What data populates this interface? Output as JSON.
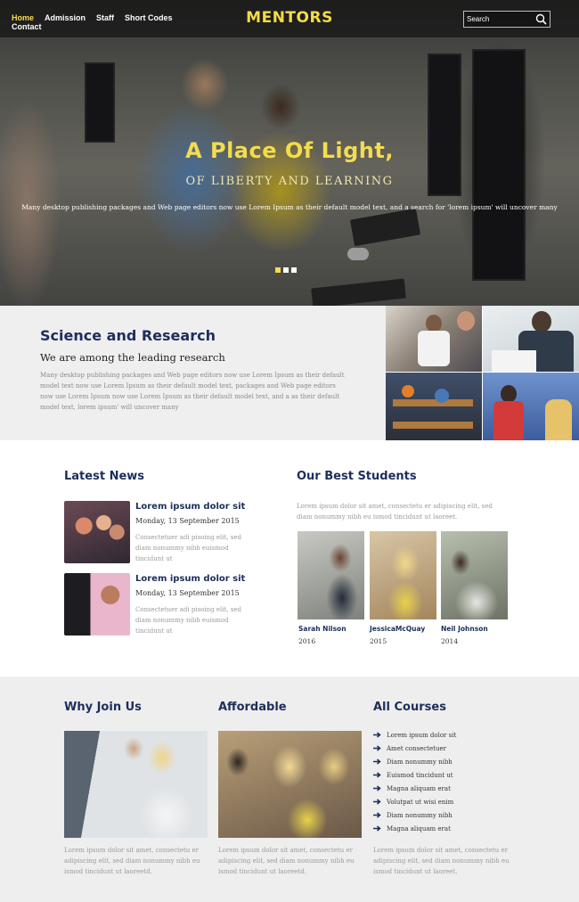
{
  "nav": {
    "items": [
      "Home",
      "Admission",
      "Staff",
      "Short Codes",
      "Contact"
    ],
    "active": "Home"
  },
  "logo": "MENTORS",
  "search": {
    "placeholder": "Search",
    "icon": "search-icon"
  },
  "hero": {
    "title": "A Place Of Light,",
    "subtitle": "OF LIBERTY AND LEARNING",
    "description": "Many desktop publishing packages and Web page editors now use Lorem Ipsum as their default model text, and a search for 'lorem ipsum' will uncover many",
    "slide_count": 3,
    "active_slide": 1
  },
  "research": {
    "title": "Science and Research",
    "subtitle": "We are among the leading research",
    "body": "Many desktop publishing packages and Web page editors now use Lorem Ipsum as their default model text now use Lorem Ipsum as their default model text, packages and Web page editors now use Lorem Ipsum now use Lorem Ipsum as their default model text, and a as their default model text, lorem ipsum' will uncover many"
  },
  "latest_news": {
    "title": "Latest News",
    "items": [
      {
        "title": "Lorem ipsum dolor sit",
        "date": "Monday, 13 September 2015",
        "text": "Consectetuer adi pisoing elit, sed diam nonummy nibh euismod tincidunt ut"
      },
      {
        "title": "Lorem ipsum dolor sit",
        "date": "Monday, 13 September 2015",
        "text": "Consectetuer adi pisoing elit, sed diam nonummy nibh euismod tincidunt ut"
      }
    ]
  },
  "best_students": {
    "title": "Our Best Students",
    "intro": "Lorem ipsum dolor sit amet, consectetu er adipiscing elit, sed diam nonummy nibh eu ismod tincidunt ut laoreet.",
    "students": [
      {
        "name": "Sarah Nilson",
        "year": "2016"
      },
      {
        "name": "JessicaMcQuay",
        "year": "2015"
      },
      {
        "name": "Neil Johnson",
        "year": "2014"
      }
    ]
  },
  "why_join": {
    "title": "Why Join Us",
    "text": "Lorem ipsum dolor sit amet, consectetu er adipiscing elit, sed diam nonummy nibh eu ismod tincidunt ut laoreetd."
  },
  "affordable": {
    "title": "Affordable",
    "text": "Lorem ipsum dolor sit amet, consectetu er adipiscing elit, sed diam nonummy nibh eu ismod tincidunt ut laoreetd."
  },
  "all_courses": {
    "title": "All Courses",
    "items": [
      "Lorem ipsum dolor sit",
      "Amet consectetuer",
      "Diam nonummy nibh",
      "Euismod tincidunt ut",
      "Magna aliquam erat",
      "Volutpat ut wisi enim",
      "Diam nonummy nibh",
      "Magna aliquam erat"
    ],
    "text": "Lorem ipsum dolor sit amet, consectetu er adipiscing elit, sed diam nonummy nibh eu ismod tincidunt ut laoreet."
  },
  "colors": {
    "navy": "#1d2e5c",
    "yellow": "#f3dc4e",
    "muted": "#9a9a9a"
  }
}
